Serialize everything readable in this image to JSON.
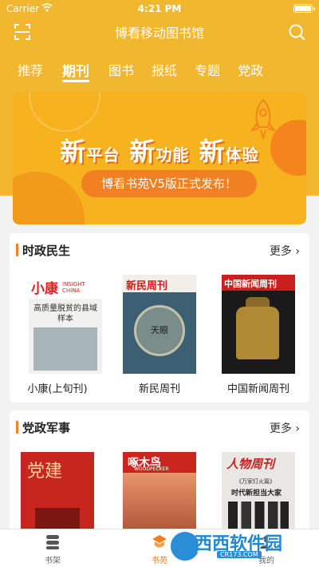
{
  "status_bar": {
    "carrier": "Carrier",
    "time": "4:21 PM"
  },
  "header": {
    "title": "博看移动图书馆"
  },
  "tabs": [
    {
      "label": "推荐"
    },
    {
      "label": "期刊"
    },
    {
      "label": "图书"
    },
    {
      "label": "报纸"
    },
    {
      "label": "专题"
    },
    {
      "label": "党政"
    }
  ],
  "active_tab": "期刊",
  "banner": {
    "w1": "新",
    "p1": "平台",
    "w2": "新",
    "p2": "功能",
    "w3": "新",
    "p3": "体验",
    "subtitle": "博看书苑V5版正式发布！"
  },
  "sections": [
    {
      "title": "时政民生",
      "more": "更多",
      "books": [
        {
          "label": "小康(上旬刊)",
          "cover_title": "小康",
          "cover_en": "INSIGHT CHINA",
          "cover_headline": "高质量脱贫的县域样本"
        },
        {
          "label": "新民周刊",
          "cover_title": "新民周刊",
          "cover_text": "天眼"
        },
        {
          "label": "中国新闻周刊",
          "cover_title": "中国新闻周刊"
        }
      ]
    },
    {
      "title": "党政军事",
      "more": "更多",
      "books": [
        {
          "cover_title": "党建"
        },
        {
          "cover_title": "啄木鸟",
          "cover_en": "WOODPECKER"
        },
        {
          "cover_title": "人物周刊",
          "cover_line": "《万家灯火篇》",
          "cover_line2": "时代新担当大家"
        }
      ]
    }
  ],
  "tabbar": [
    {
      "label": "书架",
      "icon": "bookshelf-icon"
    },
    {
      "label": "书苑",
      "icon": "library-icon"
    },
    {
      "label": "我的",
      "icon": "profile-icon"
    }
  ],
  "watermark": {
    "text": "西西软件园",
    "url": "CR173.COM"
  },
  "colors": {
    "accent": "#f08022",
    "header": "#f0b72f"
  }
}
